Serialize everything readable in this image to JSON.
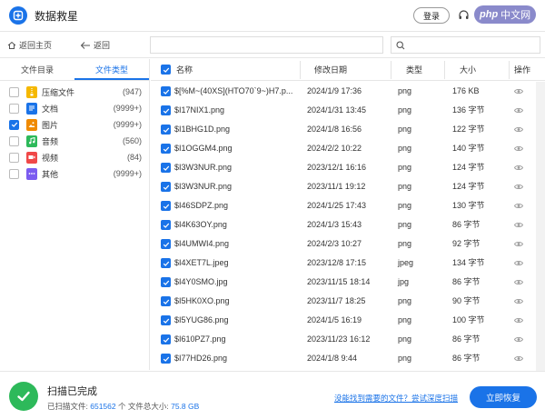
{
  "app": {
    "title": "数据救星",
    "login_label": "登录",
    "watermark_prefix": "php",
    "watermark_text": "中文网"
  },
  "nav": {
    "home_label": "返回主页",
    "back_label": "返回"
  },
  "left": {
    "tabs": [
      {
        "label": "文件目录",
        "active": false
      },
      {
        "label": "文件类型",
        "active": true
      }
    ],
    "categories": [
      {
        "label": "压缩文件",
        "count": "(947)",
        "checked": false,
        "icon": "zip-icon",
        "color": "#f5b800"
      },
      {
        "label": "文档",
        "count": "(9999+)",
        "checked": false,
        "icon": "document-icon",
        "color": "#1a73e8"
      },
      {
        "label": "图片",
        "count": "(9999+)",
        "checked": true,
        "icon": "image-icon",
        "color": "#f08a00"
      },
      {
        "label": "音频",
        "count": "(560)",
        "checked": false,
        "icon": "audio-icon",
        "color": "#2db95a"
      },
      {
        "label": "视频",
        "count": "(84)",
        "checked": false,
        "icon": "video-icon",
        "color": "#f04848"
      },
      {
        "label": "其他",
        "count": "(9999+)",
        "checked": false,
        "icon": "other-icon",
        "color": "#7b5cf0"
      }
    ]
  },
  "table": {
    "headers": {
      "name": "名称",
      "date": "修改日期",
      "type": "类型",
      "size": "大小",
      "action": "操作"
    },
    "rows": [
      {
        "name": "$[%M~(40XS](HTO70`9~)H7.p...",
        "date": "2024/1/9 17:36",
        "type": "png",
        "size": "176 KB"
      },
      {
        "name": "$I17NIX1.png",
        "date": "2024/1/31 13:45",
        "type": "png",
        "size": "136 字节"
      },
      {
        "name": "$I1BHG1D.png",
        "date": "2024/1/8 16:56",
        "type": "png",
        "size": "122 字节"
      },
      {
        "name": "$I1OGGM4.png",
        "date": "2024/2/2 10:22",
        "type": "png",
        "size": "140 字节"
      },
      {
        "name": "$I3W3NUR.png",
        "date": "2023/12/1 16:16",
        "type": "png",
        "size": "124 字节"
      },
      {
        "name": "$I3W3NUR.png",
        "date": "2023/11/1 19:12",
        "type": "png",
        "size": "124 字节"
      },
      {
        "name": "$I46SDPZ.png",
        "date": "2024/1/25 17:43",
        "type": "png",
        "size": "130 字节"
      },
      {
        "name": "$I4K63OY.png",
        "date": "2024/1/3 15:43",
        "type": "png",
        "size": "86 字节"
      },
      {
        "name": "$I4UMWI4.png",
        "date": "2024/2/3 10:27",
        "type": "png",
        "size": "92 字节"
      },
      {
        "name": "$I4XET7L.jpeg",
        "date": "2023/12/8 17:15",
        "type": "jpeg",
        "size": "134 字节"
      },
      {
        "name": "$I4Y0SMO.jpg",
        "date": "2023/11/15 18:14",
        "type": "jpg",
        "size": "86 字节"
      },
      {
        "name": "$I5HK0XO.png",
        "date": "2023/11/7 18:25",
        "type": "png",
        "size": "90 字节"
      },
      {
        "name": "$I5YUG86.png",
        "date": "2024/1/5 16:19",
        "type": "png",
        "size": "100 字节"
      },
      {
        "name": "$I610PZ7.png",
        "date": "2023/11/23 16:12",
        "type": "png",
        "size": "86 字节"
      },
      {
        "name": "$I77HD26.png",
        "date": "2024/1/8 9:44",
        "type": "png",
        "size": "86 字节"
      }
    ]
  },
  "footer": {
    "status_title": "扫描已完成",
    "scanned_label": "已扫描文件:",
    "scanned_count": "651562",
    "count_unit": "个 文件总大小:",
    "total_size": "75.8 GB",
    "help_link": "没能找到需要的文件？尝试深度扫描",
    "recover_label": "立即恢复"
  },
  "colors": {
    "accent": "#1a73e8",
    "success": "#2db95a"
  }
}
